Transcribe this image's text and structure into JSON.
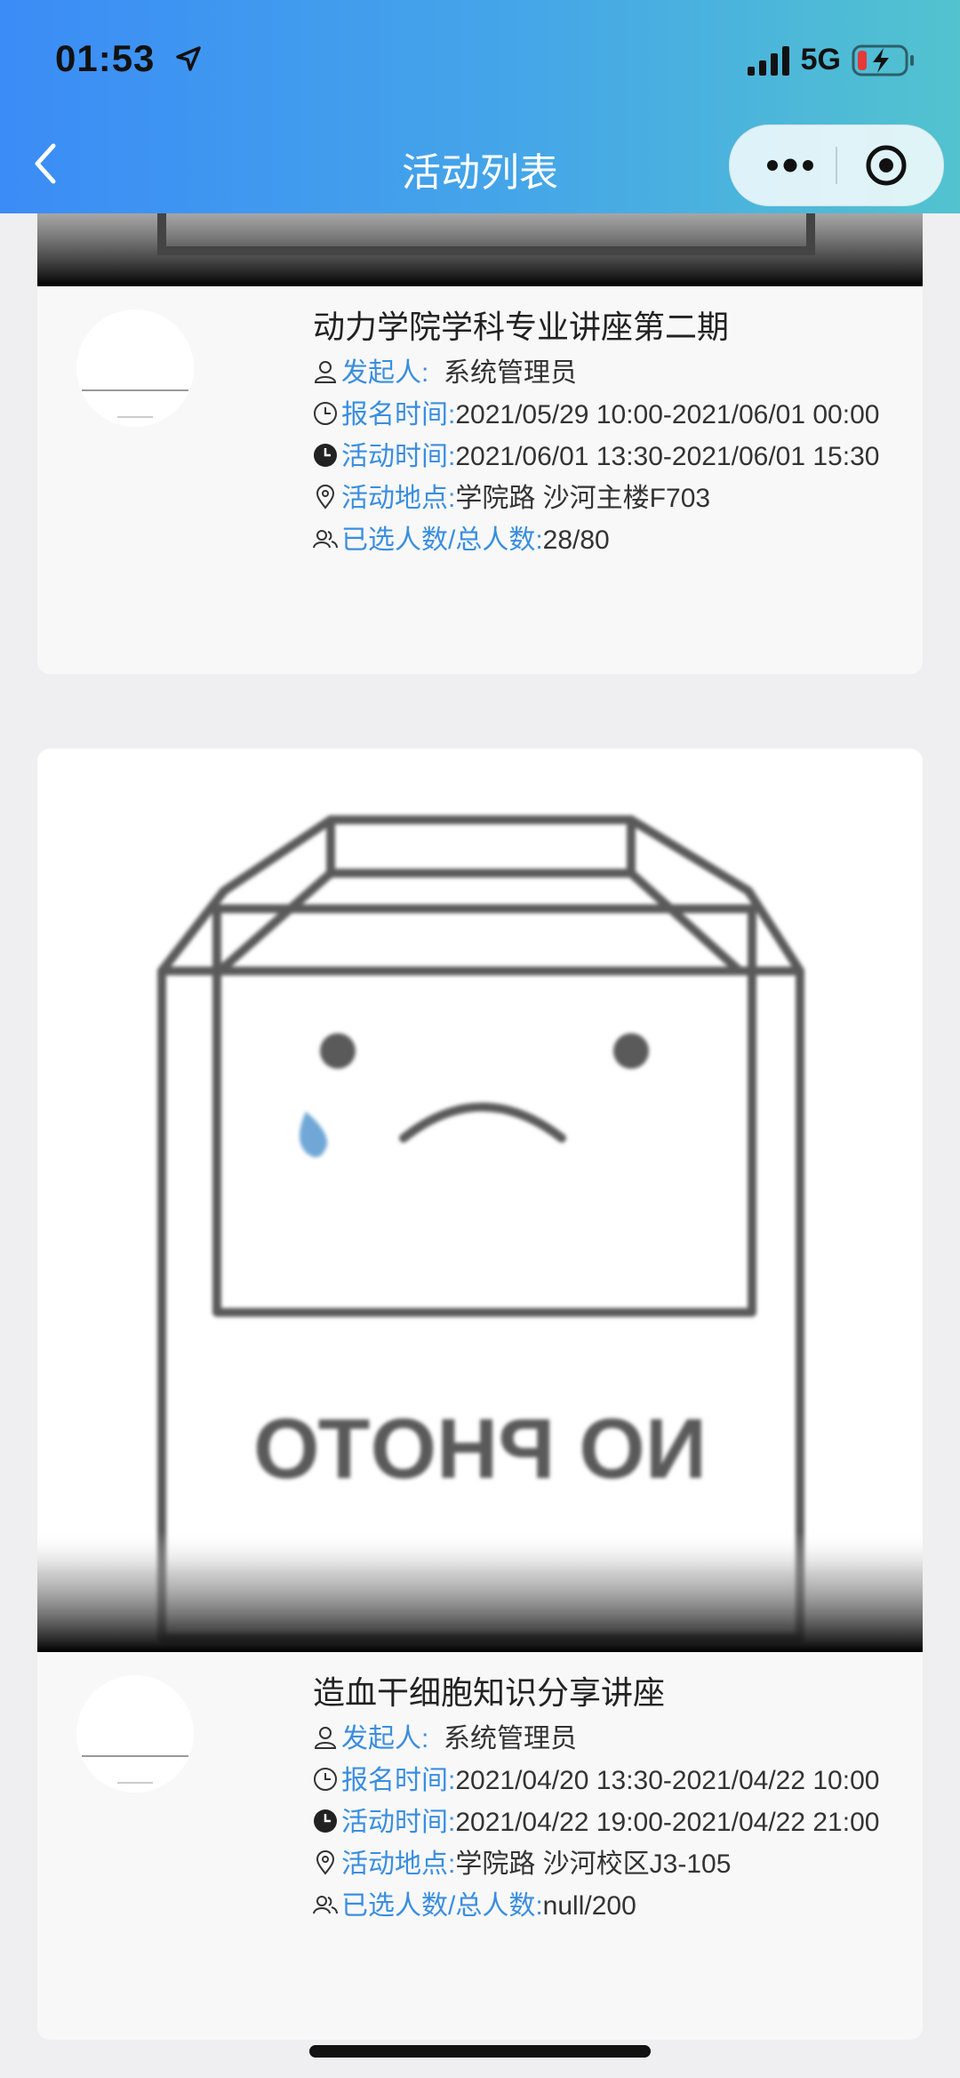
{
  "status_bar": {
    "time": "01:53",
    "network": "5G"
  },
  "nav": {
    "title": "活动列表"
  },
  "photo_placeholder_text": "NO PHOTO",
  "activities": [
    {
      "title": "动力学院学科专业讲座第二期",
      "organizer_label": "发起人:",
      "organizer": "系统管理员",
      "signup_label": "报名时间:",
      "signup_time": "2021/05/29 10:00-2021/06/01 00:00",
      "activity_label": "活动时间:",
      "activity_time": "2021/06/01 13:30-2021/06/01 15:30",
      "location_label": "活动地点:",
      "location": "学院路 沙河主楼F703",
      "count_label": "已选人数/总人数:",
      "count": "28/80"
    },
    {
      "title": "造血干细胞知识分享讲座",
      "organizer_label": "发起人:",
      "organizer": "系统管理员",
      "signup_label": "报名时间:",
      "signup_time": "2021/04/20 13:30-2021/04/22 10:00",
      "activity_label": "活动时间:",
      "activity_time": "2021/04/22 19:00-2021/04/22 21:00",
      "location_label": "活动地点:",
      "location": "学院路 沙河校区J3-105",
      "count_label": "已选人数/总人数:",
      "count": "null/200"
    }
  ]
}
